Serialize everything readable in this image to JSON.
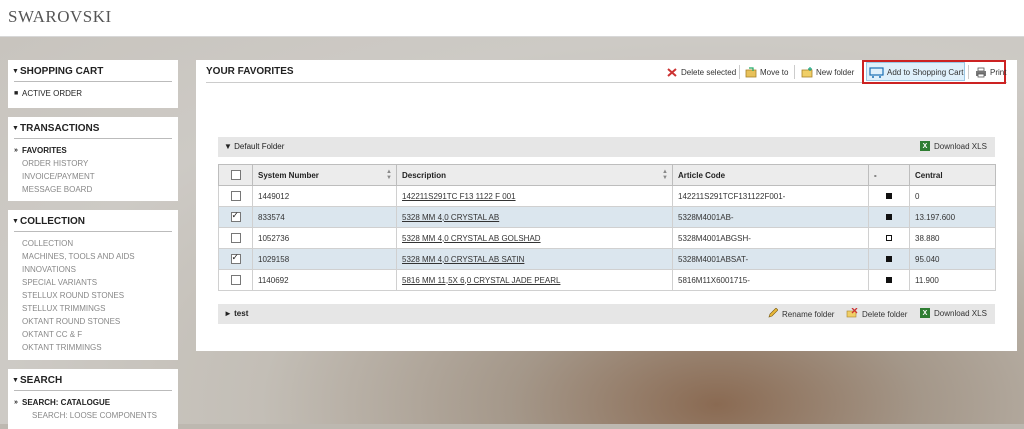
{
  "header": {
    "logo": "SWAROVSKI"
  },
  "sidebar": {
    "shopping_cart": {
      "title": "SHOPPING CART",
      "items": [
        "ACTIVE ORDER"
      ]
    },
    "transactions": {
      "title": "TRANSACTIONS",
      "items": [
        "FAVORITES",
        "ORDER HISTORY",
        "INVOICE/PAYMENT",
        "MESSAGE BOARD"
      ]
    },
    "collection": {
      "title": "COLLECTION",
      "items": [
        "COLLECTION",
        "MACHINES, TOOLS AND AIDS",
        "INNOVATIONS",
        "SPECIAL VARIANTS",
        "STELLUX ROUND STONES",
        "STELLUX TRIMMINGS",
        "OKTANT ROUND STONES",
        "OKTANT CC & F",
        "OKTANT TRIMMINGS"
      ]
    },
    "search": {
      "title": "SEARCH",
      "items": [
        "SEARCH: CATALOGUE",
        "SEARCH: LOOSE COMPONENTS"
      ]
    }
  },
  "main": {
    "title": "YOUR FAVORITES",
    "toolbar": {
      "delete_selected": "Delete selected",
      "move_to": "Move to",
      "new_folder": "New folder",
      "add_to_cart": "Add to Shopping Cart",
      "print": "Print"
    },
    "folders": [
      {
        "name": "Default Folder",
        "expanded": true,
        "download": "Download XLS"
      },
      {
        "name": "test",
        "expanded": false,
        "rename": "Rename folder",
        "delete": "Delete folder",
        "download": "Download XLS"
      }
    ],
    "table": {
      "columns": [
        "System Number",
        "Description",
        "Article Code",
        "-",
        "Central"
      ],
      "rows": [
        {
          "system": "1449012",
          "desc": "142211S291TC F13 1122 F 001",
          "article": "142211S291TCF131122F001-",
          "central": "0",
          "checked": false,
          "status": "filled"
        },
        {
          "system": "833574",
          "desc": "5328 MM 4,0 CRYSTAL AB",
          "article": "5328M4001AB-",
          "central": "13.197.600",
          "checked": true,
          "status": "filled"
        },
        {
          "system": "1052736",
          "desc": "5328 MM 4,0 CRYSTAL AB GOLSHAD",
          "article": "5328M4001ABGSH-",
          "central": "38.880",
          "checked": false,
          "status": "hollow"
        },
        {
          "system": "1029158",
          "desc": "5328 MM 4,0 CRYSTAL AB SATIN",
          "article": "5328M4001ABSAT-",
          "central": "95.040",
          "checked": true,
          "status": "filled"
        },
        {
          "system": "1140692",
          "desc": "5816 MM 11,5X 6,0 CRYSTAL JADE PEARL",
          "article": "5816M11X6001715-",
          "central": "11.900",
          "checked": false,
          "status": "filled"
        }
      ]
    }
  }
}
